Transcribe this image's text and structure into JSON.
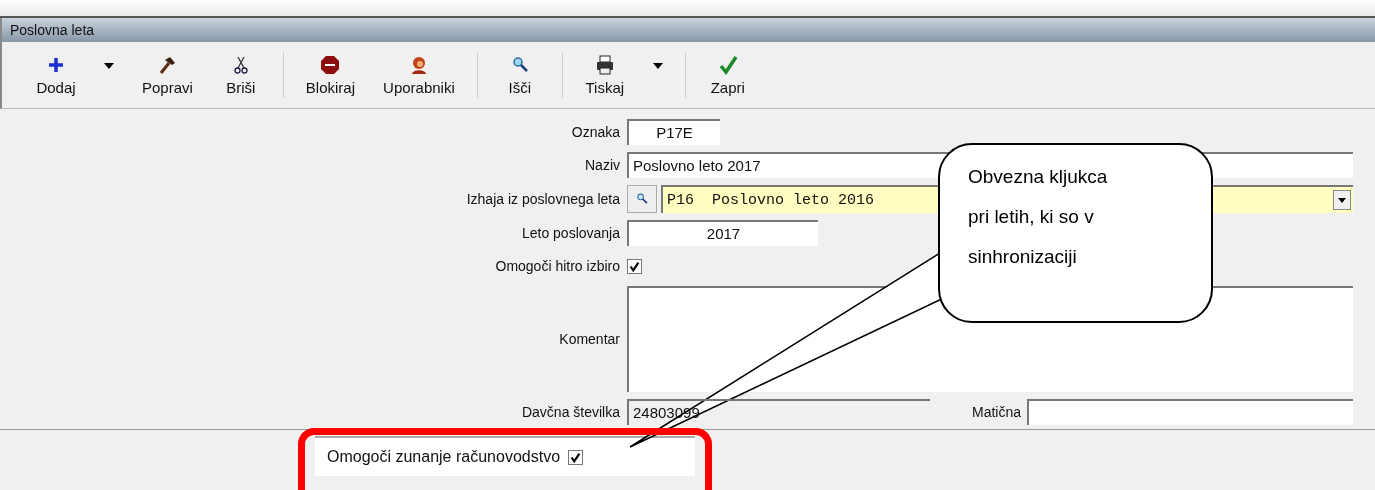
{
  "window": {
    "title": "Poslovna leta"
  },
  "toolbar": {
    "groups": [
      [
        {
          "label": "Dodaj",
          "dropdown": true
        },
        {
          "label": "Popravi",
          "dropdown": false
        },
        {
          "label": "Briši",
          "dropdown": false
        }
      ],
      [
        {
          "label": "Blokiraj",
          "dropdown": false
        },
        {
          "label": "Uporabniki",
          "dropdown": false
        }
      ],
      [
        {
          "label": "Išči",
          "dropdown": false
        }
      ],
      [
        {
          "label": "Tiskaj",
          "dropdown": true
        }
      ],
      [
        {
          "label": "Zapri",
          "dropdown": false
        }
      ]
    ]
  },
  "form": {
    "fields": [
      {
        "kind": "short",
        "label": "Oznaka",
        "value": "P17E"
      },
      {
        "kind": "text",
        "label": "Naziv",
        "value": "Poslovno leto 2017"
      },
      {
        "kind": "lookup",
        "label": "Izhaja iz poslovnega leta",
        "value": "P16  Poslovno leto 2016"
      },
      {
        "kind": "year",
        "label": "Leto poslovanja",
        "value": "2017"
      },
      {
        "kind": "checkbox",
        "label": "Omogoči hitro izbiro",
        "checked": true
      },
      {
        "kind": "textarea",
        "label": "Komentar"
      },
      {
        "kind": "pair",
        "label": "Davčna številka",
        "value": "24803099",
        "label_2": "Matična"
      }
    ]
  },
  "bottom": {
    "label": "Omogoči zunanje računovodstvo",
    "checked": true
  },
  "callout": {
    "text": "Obvezna kljukca pri letih, ki so v sinhronizaciji"
  }
}
